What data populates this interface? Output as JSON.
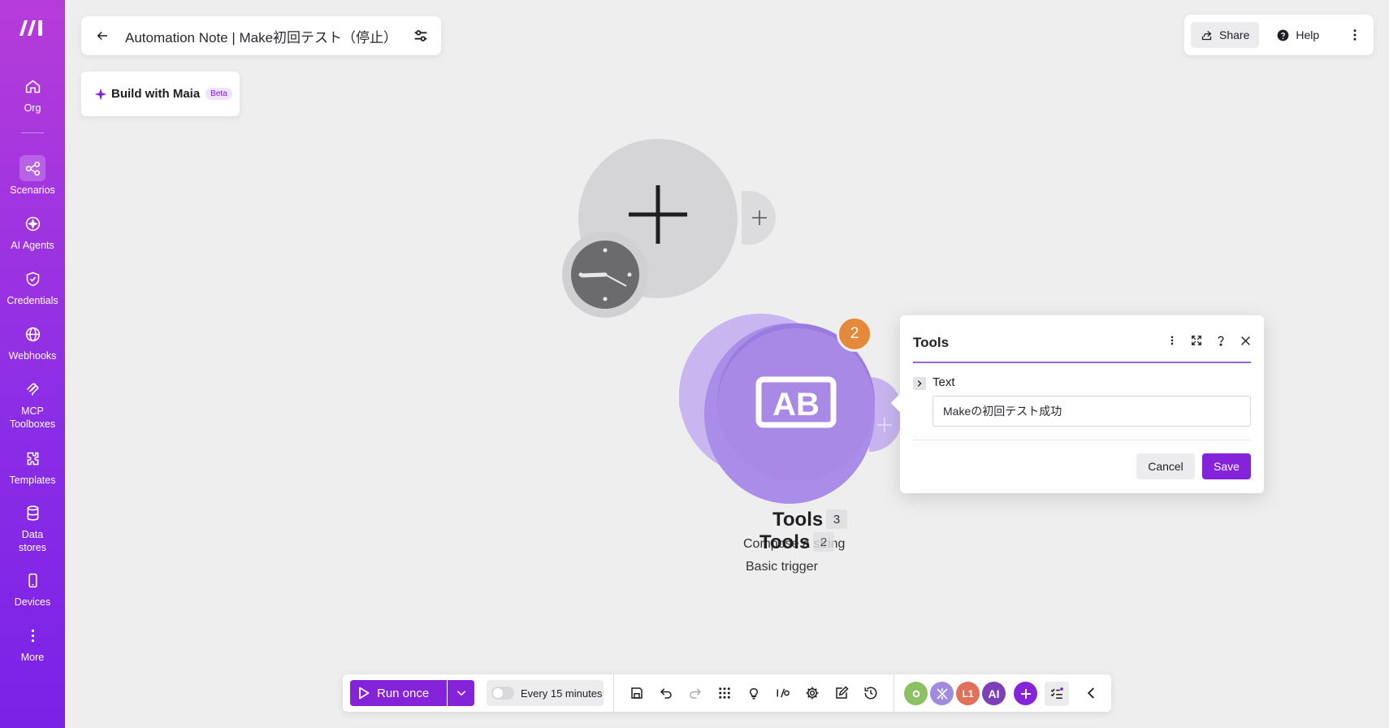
{
  "sidebar": {
    "items": [
      {
        "label": "Org",
        "icon": "home-icon"
      },
      {
        "label": "Scenarios",
        "icon": "scenarios-icon"
      },
      {
        "label": "AI Agents",
        "icon": "ai-agents-icon"
      },
      {
        "label": "Credentials",
        "icon": "shield-check-icon"
      },
      {
        "label": "Webhooks",
        "icon": "globe-icon"
      },
      {
        "label": "MCP Toolboxes",
        "icon": "mcp-icon"
      },
      {
        "label": "Templates",
        "icon": "puzzle-icon"
      },
      {
        "label": "Data stores",
        "icon": "database-icon"
      },
      {
        "label": "Devices",
        "icon": "phone-icon"
      },
      {
        "label": "More",
        "icon": "more-vertical-icon"
      }
    ]
  },
  "header": {
    "title": "Automation Note | Make初回テスト（停止）",
    "maia_label": "Build with Maia",
    "beta": "Beta",
    "share": "Share",
    "help": "Help"
  },
  "canvas": {
    "tools_node_count": "2",
    "label_tools_top": "Tools",
    "label_tools_top_count": "3",
    "label_tools_bottom": "Tools",
    "label_tools_bottom_count": "2",
    "label_sub_1": "Compose a string",
    "label_sub_2": "Basic trigger"
  },
  "popover": {
    "title": "Tools",
    "field_label": "Text",
    "field_value": "Makeの初回テスト成功",
    "cancel": "Cancel",
    "save": "Save"
  },
  "toolbar": {
    "run_once": "Run once",
    "schedule": "Every 15 minutes",
    "apps": [
      {
        "label": "",
        "color": "#8cc063"
      },
      {
        "label": "",
        "color": "#a18be0"
      },
      {
        "label": "L1",
        "color": "#e0705a"
      },
      {
        "label": "AI",
        "color": "#7b3fb8"
      }
    ]
  },
  "colors": {
    "accent": "#8423d9",
    "sidebar_top": "#b63cd9",
    "sidebar_bottom": "#7a22e6",
    "tools_node": "#a98de8",
    "badge_orange": "#e4883a"
  }
}
